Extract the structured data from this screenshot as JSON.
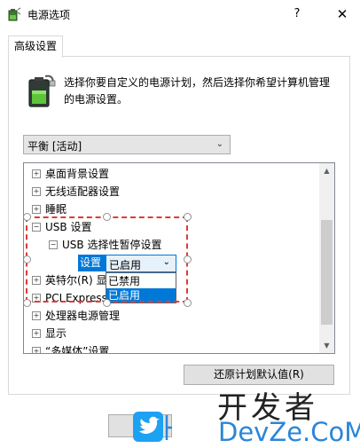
{
  "window": {
    "title": "电源选项",
    "help_glyph": "?",
    "close_glyph": "✕"
  },
  "tabs": [
    {
      "label": "高级设置"
    }
  ],
  "description": "选择你要自定义的电源计划，然后选择你希望计算机管理的电源设置。",
  "plan_select": {
    "value": "平衡 [活动]"
  },
  "tree": {
    "items": [
      {
        "label": "桌面背景设置",
        "expander": "+"
      },
      {
        "label": "无线适配器设置",
        "expander": "+"
      },
      {
        "label": "睡眠",
        "expander": "+"
      },
      {
        "label": "USB 设置",
        "expander": "−"
      },
      {
        "label": "USB 选择性暂停设置",
        "expander": "−"
      },
      {
        "label": "设置",
        "expander": ""
      },
      {
        "label": "英特尔(R) 显",
        "expander": "+"
      },
      {
        "label": "PCI Express",
        "expander": "+"
      },
      {
        "label": "处理器电源管理",
        "expander": "+"
      },
      {
        "label": "显示",
        "expander": "+"
      },
      {
        "label": "“多媒体”设置",
        "expander": "+"
      }
    ]
  },
  "setting_combo": {
    "value": "已启用",
    "options": [
      "已禁用",
      "已启用"
    ],
    "selected_index": 1
  },
  "buttons": {
    "restore": "还原计划默认值(R)"
  },
  "watermark": {
    "top": "开发者",
    "bottom": "DevZe.CoM"
  },
  "colors": {
    "accent": "#0078d7",
    "annotation": "#e03a3a",
    "watermark_blue": "#2a86d8"
  },
  "icons": {
    "app": "power-options-icon",
    "battery": "battery-plug-icon",
    "watermark": "twitter-bird-icon"
  }
}
